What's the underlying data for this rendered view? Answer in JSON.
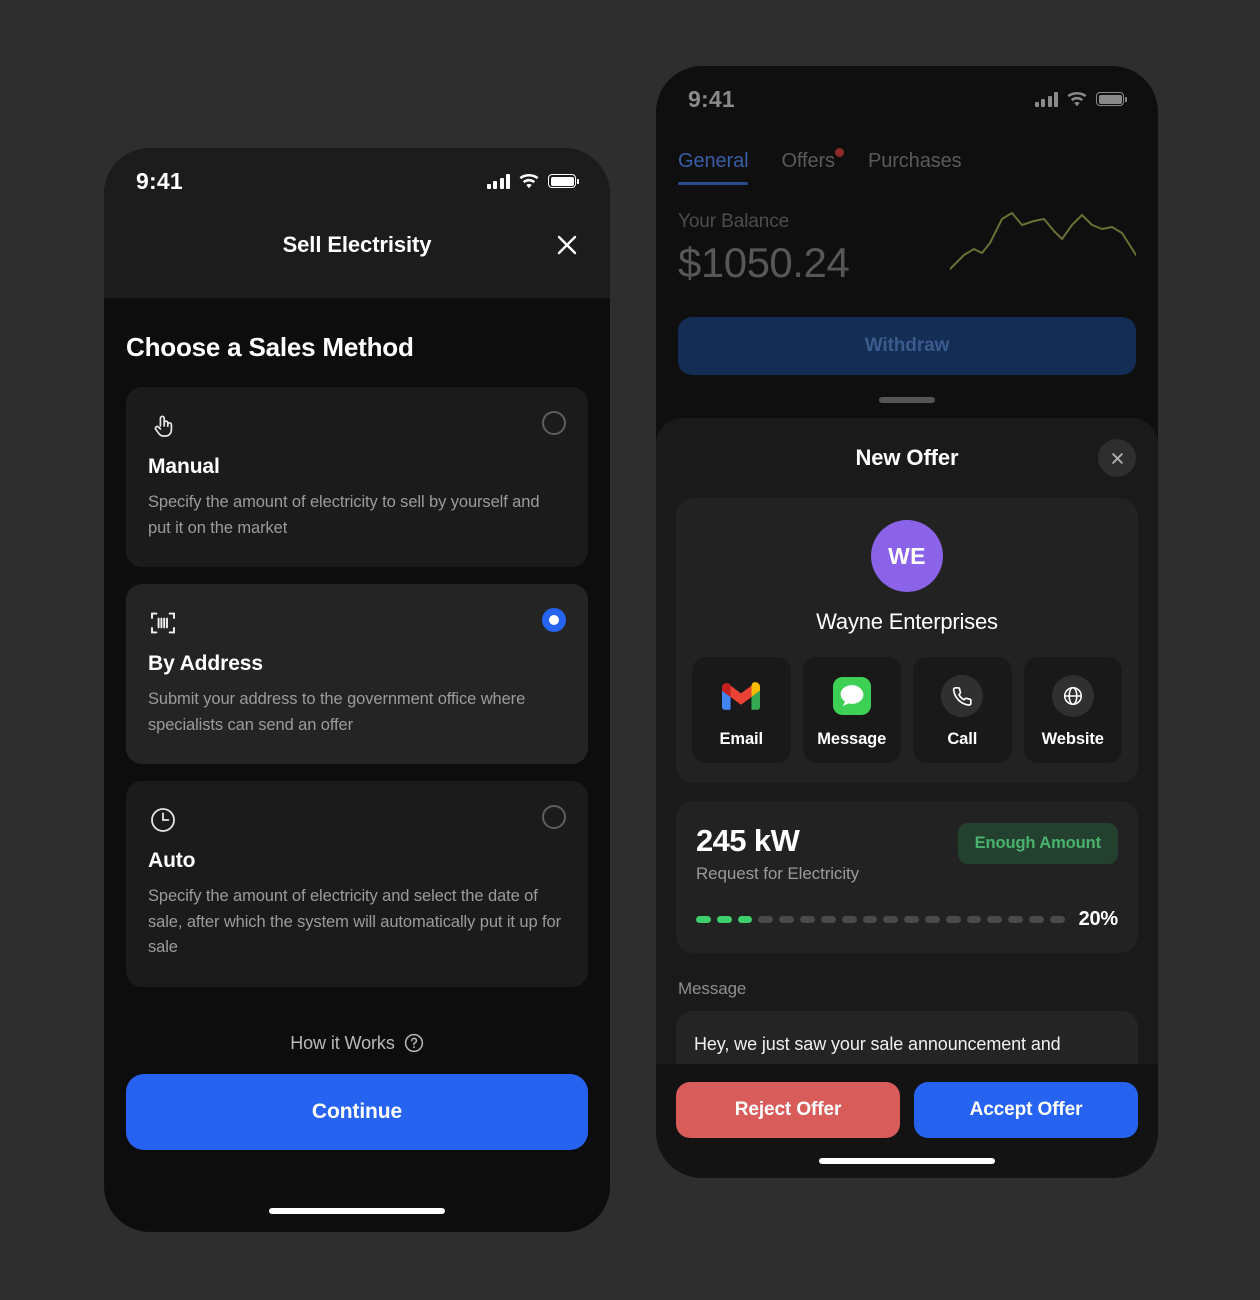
{
  "colors": {
    "page_background": "#2e2e2e",
    "accent_blue": "#2563f0",
    "reject_red": "#d85c59",
    "avatar_purple": "#8b63e9",
    "success_green": "#3ece6c",
    "badge_text_green": "#49b36e",
    "badge_bg_green": "#24402f",
    "notification_dot_red": "#8c2a26"
  },
  "left_phone": {
    "status_bar": {
      "time": "9:41",
      "signal_icon": "cellular-signal-icon",
      "wifi_icon": "wifi-icon",
      "battery_icon": "battery-full-icon"
    },
    "navbar": {
      "title": "Sell Electrisity",
      "close_icon": "close-icon"
    },
    "heading": "Choose a Sales Method",
    "options": [
      {
        "icon": "pointing-hand-icon",
        "name": "Manual",
        "description": "Specify the amount of electricity to sell by yourself and put it on the market",
        "selected": false
      },
      {
        "icon": "barcode-scan-icon",
        "name": "By Address",
        "description": "Submit your address to the government office where specialists can send an offer",
        "selected": true
      },
      {
        "icon": "clock-icon",
        "name": "Auto",
        "description": "Specify the amount of electricity and select the date of sale, after which the system will automatically put it up for sale",
        "selected": false
      }
    ],
    "how_it_works": {
      "label": "How it Works",
      "icon": "question-mark-circle-icon"
    },
    "continue_button": "Continue"
  },
  "right_phone": {
    "status_bar": {
      "time": "9:41",
      "signal_icon": "cellular-signal-icon",
      "wifi_icon": "wifi-icon",
      "battery_icon": "battery-full-icon"
    },
    "tabs": [
      {
        "label": "General",
        "active": true,
        "badge": false
      },
      {
        "label": "Offers",
        "active": false,
        "badge": true
      },
      {
        "label": "Purchases",
        "active": false,
        "badge": false
      }
    ],
    "balance": {
      "label": "Your Balance",
      "amount": "$1050.24",
      "sparkline_icon": "balance-sparkline-chart"
    },
    "withdraw_button": "Withdraw",
    "sheet": {
      "title": "New Offer",
      "close_icon": "close-icon",
      "contact": {
        "avatar_initials": "WE",
        "name": "Wayne Enterprises",
        "actions": [
          {
            "label": "Email",
            "icon": "gmail-icon"
          },
          {
            "label": "Message",
            "icon": "imessage-icon"
          },
          {
            "label": "Call",
            "icon": "phone-icon"
          },
          {
            "label": "Website",
            "icon": "globe-icon"
          }
        ]
      },
      "request": {
        "amount": "245 kW",
        "subtitle": "Request for Electricity",
        "badge": "Enough Amount",
        "percent_label": "20%",
        "segments_total": 18,
        "segments_filled": 3
      },
      "message": {
        "label": "Message",
        "text": "Hey, we just saw your sale announcement and"
      },
      "reject_button": "Reject Offer",
      "accept_button": "Accept Offer"
    }
  }
}
